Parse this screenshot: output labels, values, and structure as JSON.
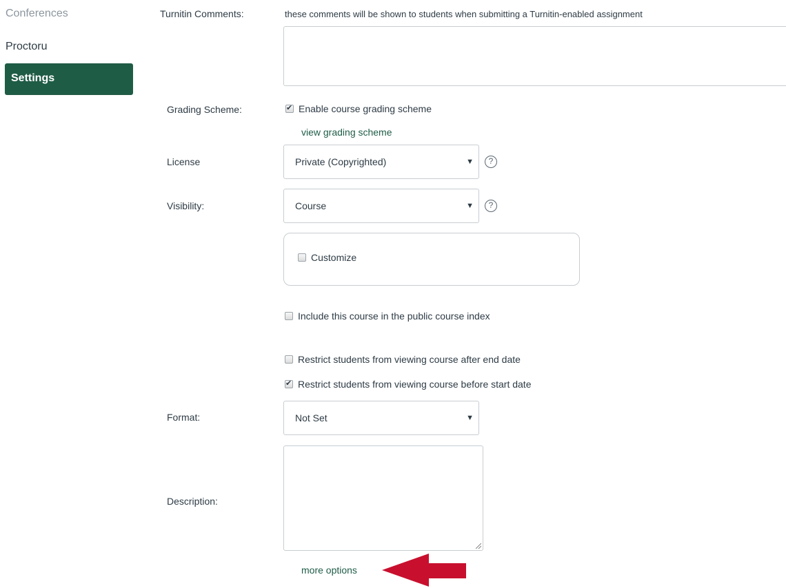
{
  "sidebar": {
    "items": [
      {
        "label": "Conferences"
      },
      {
        "label": "Proctoru"
      },
      {
        "label": "Settings"
      }
    ]
  },
  "form": {
    "turnitin": {
      "label": "Turnitin Comments:",
      "hint": "these comments will be shown to students when submitting a Turnitin-enabled assignment",
      "value": ""
    },
    "grading_scheme": {
      "label": "Grading Scheme:",
      "checkbox_label": "Enable course grading scheme",
      "checked": true,
      "view_link": "view grading scheme"
    },
    "license": {
      "label": "License",
      "selected": "Private (Copyrighted)",
      "help": "?"
    },
    "visibility": {
      "label": "Visibility:",
      "selected": "Course",
      "help": "?",
      "customize_label": "Customize",
      "customize_checked": false
    },
    "public_index": {
      "label": "Include this course in the public course index",
      "checked": false
    },
    "restrict_after_end": {
      "label": "Restrict students from viewing course after end date",
      "checked": false
    },
    "restrict_before_start": {
      "label": "Restrict students from viewing course before start date",
      "checked": true
    },
    "format": {
      "label": "Format:",
      "selected": "Not Set"
    },
    "description": {
      "label": "Description:",
      "value": ""
    },
    "more_options": "more options"
  },
  "annotation": {
    "arrow_color": "#c8102e"
  },
  "colors": {
    "brand_green": "#1f5c46",
    "text": "#2d3b45",
    "muted": "#8b969e"
  }
}
